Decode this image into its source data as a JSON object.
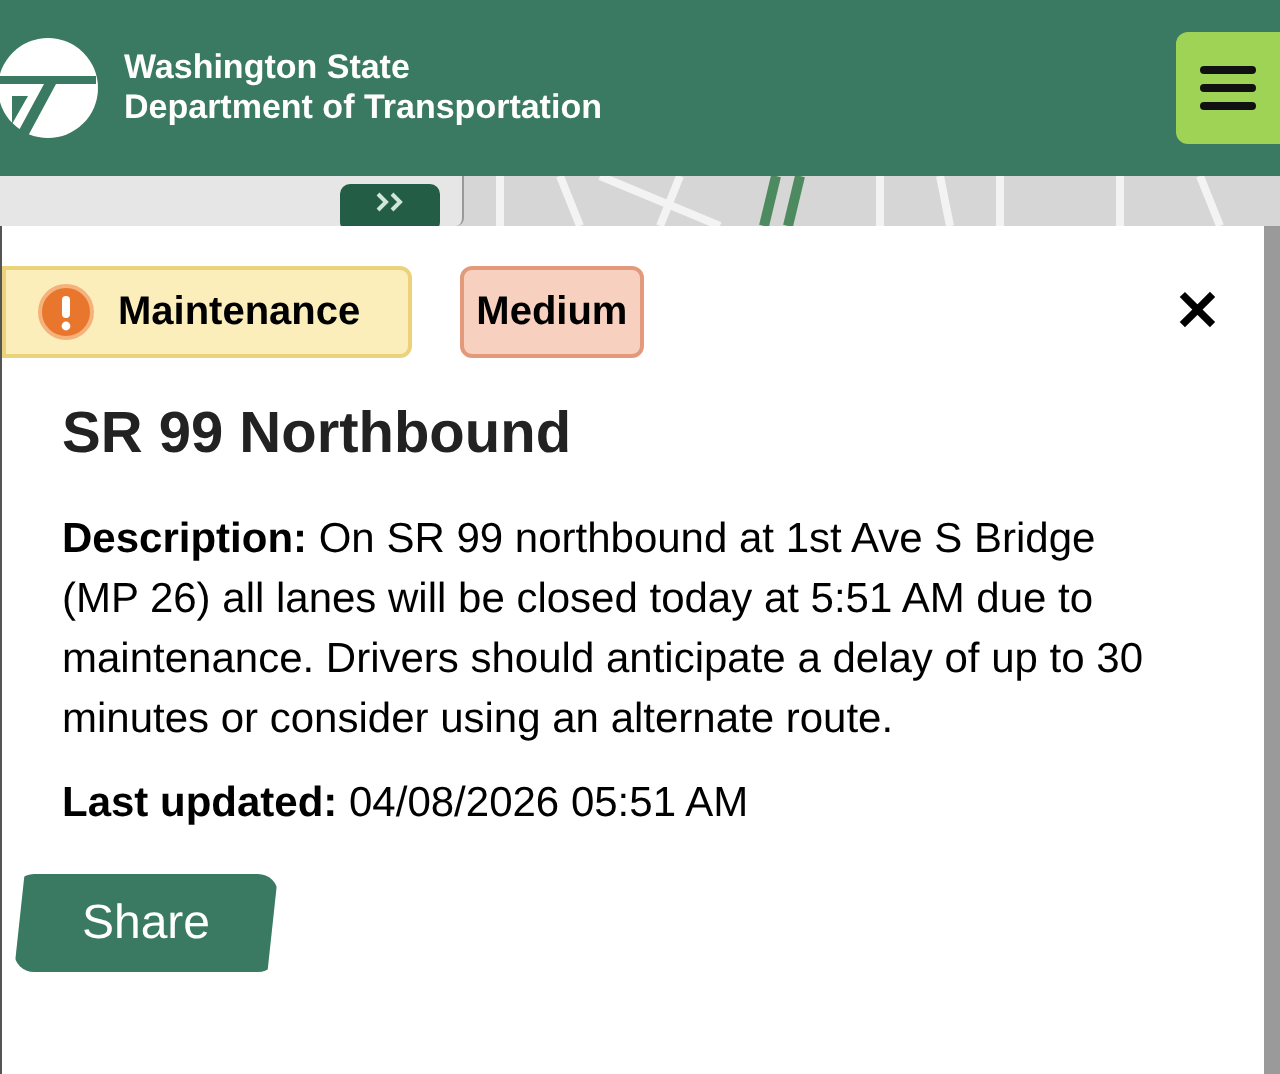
{
  "header": {
    "title_line_1": "Washington State",
    "title_line_2": "Department of Transportation"
  },
  "popup": {
    "badges": [
      {
        "kind": "category",
        "label": "Maintenance",
        "color": "#fbeebb"
      },
      {
        "kind": "severity",
        "label": "Medium",
        "color": "#f7d0bf"
      }
    ],
    "close": "✕",
    "title": "SR 99 Northbound",
    "description_label": "Description:",
    "description": "On SR 99 northbound at 1st Ave S Bridge (MP 26) all lanes will be closed today at 5:51 AM due to maintenance. Drivers should anticipate a delay of up to 30 minutes or consider using an alternate route.",
    "updated_label": "Last updated:",
    "updated": "04/08/2026 05:51 AM",
    "share": "Share"
  }
}
